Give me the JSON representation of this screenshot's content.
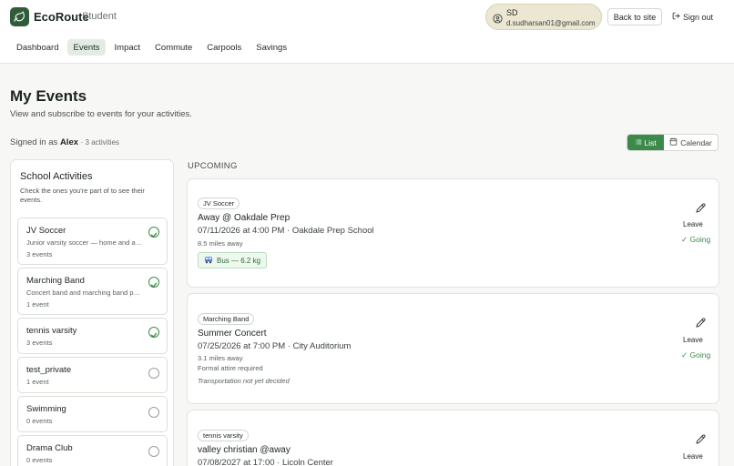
{
  "app": {
    "name": "EcoRoute",
    "role": "Student"
  },
  "user": {
    "initials": "SD",
    "email": "d.sudharsan01@gmail.com"
  },
  "header": {
    "back_label": "Back to site",
    "signout_label": "Sign out"
  },
  "nav": [
    "Dashboard",
    "Events",
    "Impact",
    "Commute",
    "Carpools",
    "Savings"
  ],
  "page": {
    "title": "My Events",
    "subtitle": "View and subscribe to events for your activities.",
    "signed_in_prefix": "Signed in as",
    "signed_in_name": "Alex",
    "activity_count": "· 3 activities"
  },
  "view_toggle": {
    "list": "List",
    "calendar": "Calendar",
    "selected": "List"
  },
  "school_activities": {
    "title": "School Activities",
    "description": "Check the ones you're part of to see their events.",
    "items": [
      {
        "name": "JV Soccer",
        "description": "Junior varsity soccer — home and away games",
        "count": "3 events",
        "checked": true
      },
      {
        "name": "Marching Band",
        "description": "Concert band and marching band performances",
        "count": "1 event",
        "checked": true
      },
      {
        "name": "tennis varsity",
        "description": "",
        "count": "3 events",
        "checked": true
      },
      {
        "name": "test_private",
        "description": "",
        "count": "1 event",
        "checked": false
      },
      {
        "name": "Swimming",
        "description": "",
        "count": "0 events",
        "checked": false
      },
      {
        "name": "Drama Club",
        "description": "",
        "count": "0 events",
        "checked": false
      }
    ]
  },
  "events": {
    "section_label": "UPCOMING",
    "leave_label": "Leave",
    "going_label": "✓ Going",
    "items": [
      {
        "tag": "JV Soccer",
        "title": "Away @ Oakdale Prep",
        "time_location": "07/11/2026 at 4:00 PM · Oakdale Prep School",
        "distance": "8.5 miles away",
        "badge": "Bus — 6.2 kg"
      },
      {
        "tag": "Marching Band",
        "title": "Summer Concert",
        "time_location": "07/25/2026 at 7:00 PM · City Auditorium",
        "distance": "3.1 miles away",
        "note": "Formal attire required",
        "transport": "Transportation not yet decided"
      },
      {
        "tag": "tennis varsity",
        "title": "valley christian @away",
        "time_location": "07/08/2027 at 17:00 · Licoln Center"
      }
    ]
  },
  "colors": {
    "brand": "#2f5d3a",
    "accent": "#3c8a4a",
    "pill": "#ebe7d3"
  }
}
